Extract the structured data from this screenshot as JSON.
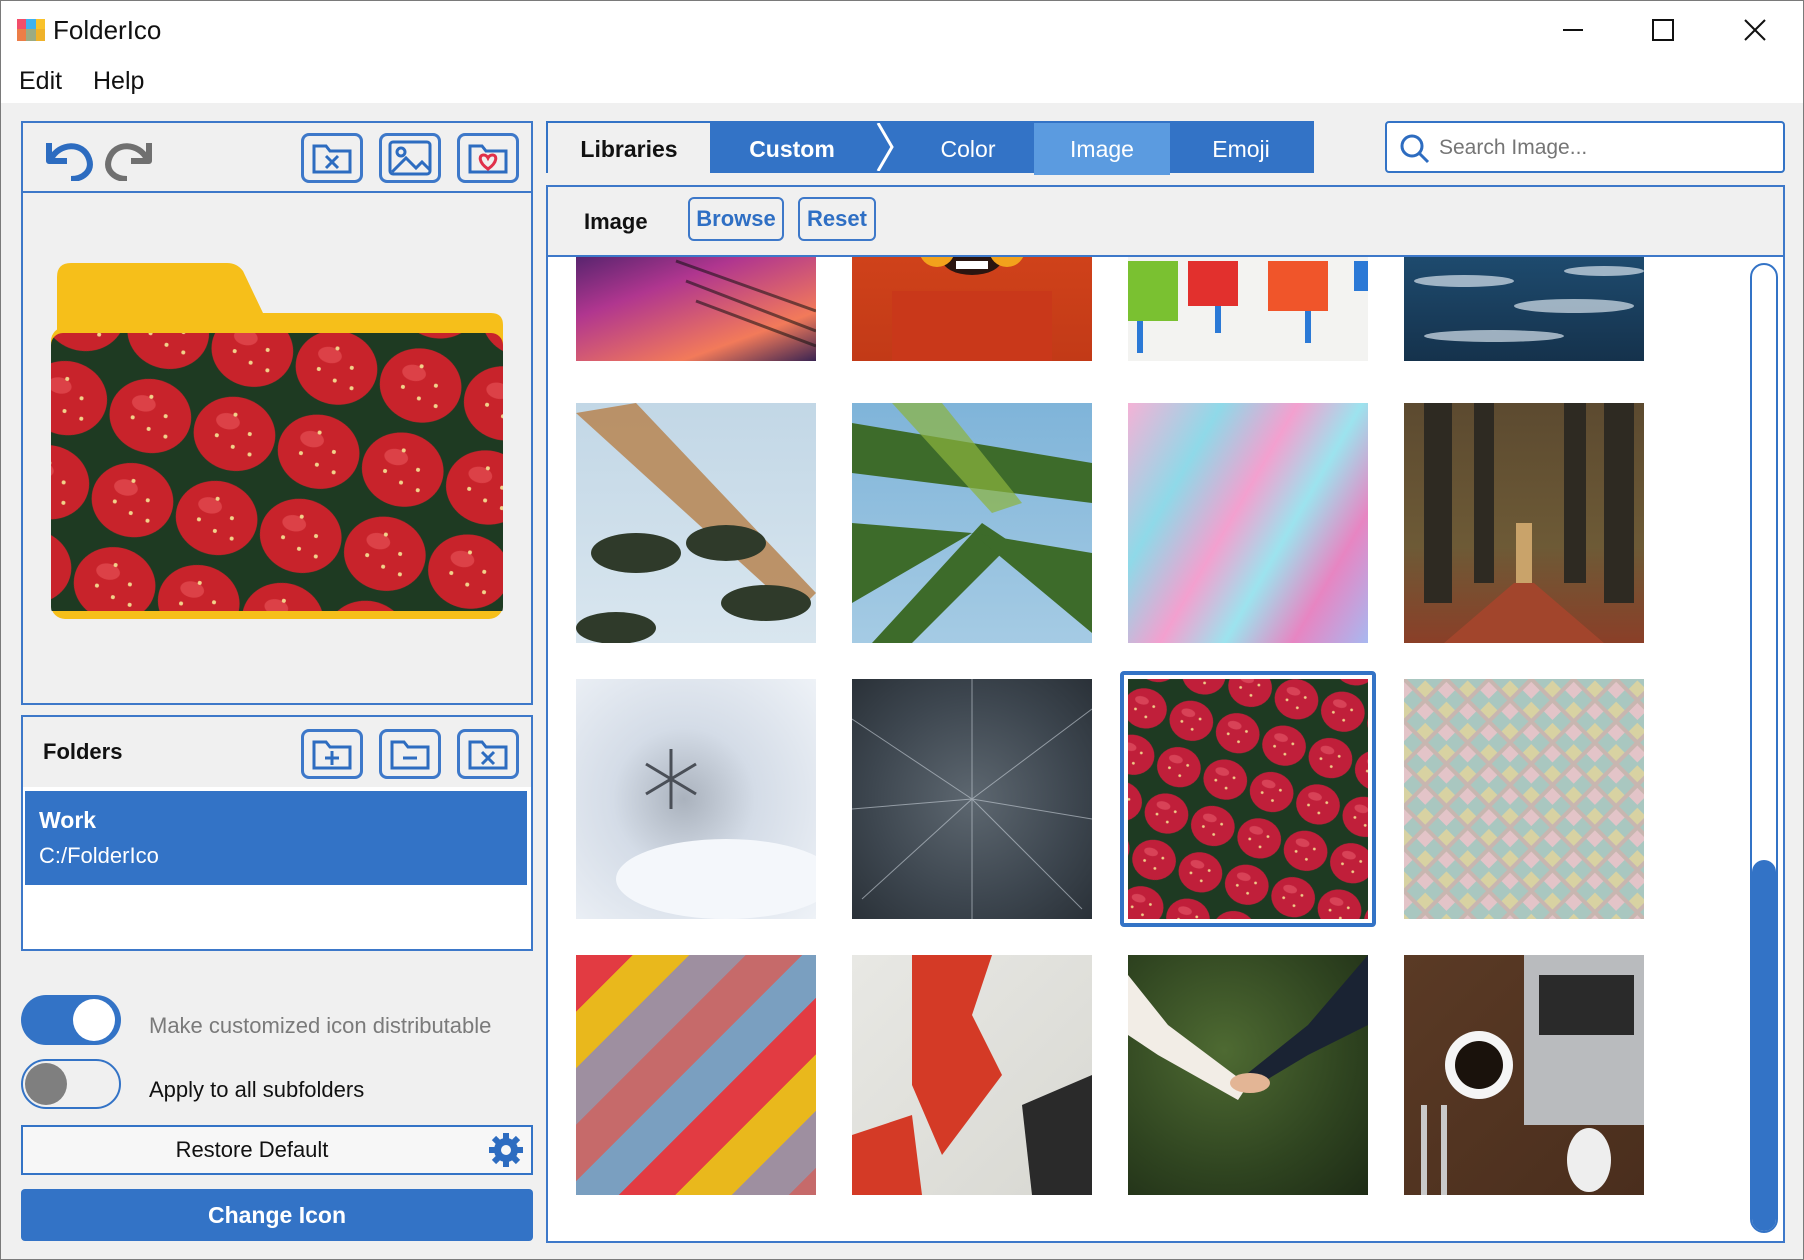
{
  "window": {
    "title": "FolderIco"
  },
  "menu": [
    "Edit",
    "Help"
  ],
  "tabs": {
    "libraries": "Libraries",
    "custom": "Custom",
    "color": "Color",
    "image": "Image",
    "emoji": "Emoji"
  },
  "search": {
    "placeholder": "Search Image..."
  },
  "image_toolbar": {
    "label": "Image",
    "browse": "Browse",
    "reset": "Reset"
  },
  "folders": {
    "header": "Folders",
    "items": [
      {
        "name": "Work",
        "path": "C:/FolderIco"
      }
    ]
  },
  "options": {
    "distributable": {
      "label": "Make customized icon distributable",
      "on": true
    },
    "subfolders": {
      "label": "Apply to all subfolders",
      "on": false
    }
  },
  "buttons": {
    "restore": "Restore Default",
    "change": "Change Icon"
  },
  "gallery": {
    "selected": "strawberries",
    "scroll_position": 0.62,
    "thumbnails": [
      "laptop-keyboard",
      "woman-orange-glasses",
      "paint-rollers",
      "ocean-waves",
      "palm-trees-sky",
      "palm-leaves",
      "pink-blue-paint",
      "forest-path",
      "snowflake",
      "starfield",
      "strawberries",
      "pastel-tiles",
      "striped-wood",
      "torn-posters",
      "holding-hands",
      "coffee-laptop"
    ]
  },
  "colors": {
    "accent": "#3373c6",
    "tab_active": "#5b9be0",
    "folder_tab": "#f6bf1a"
  }
}
